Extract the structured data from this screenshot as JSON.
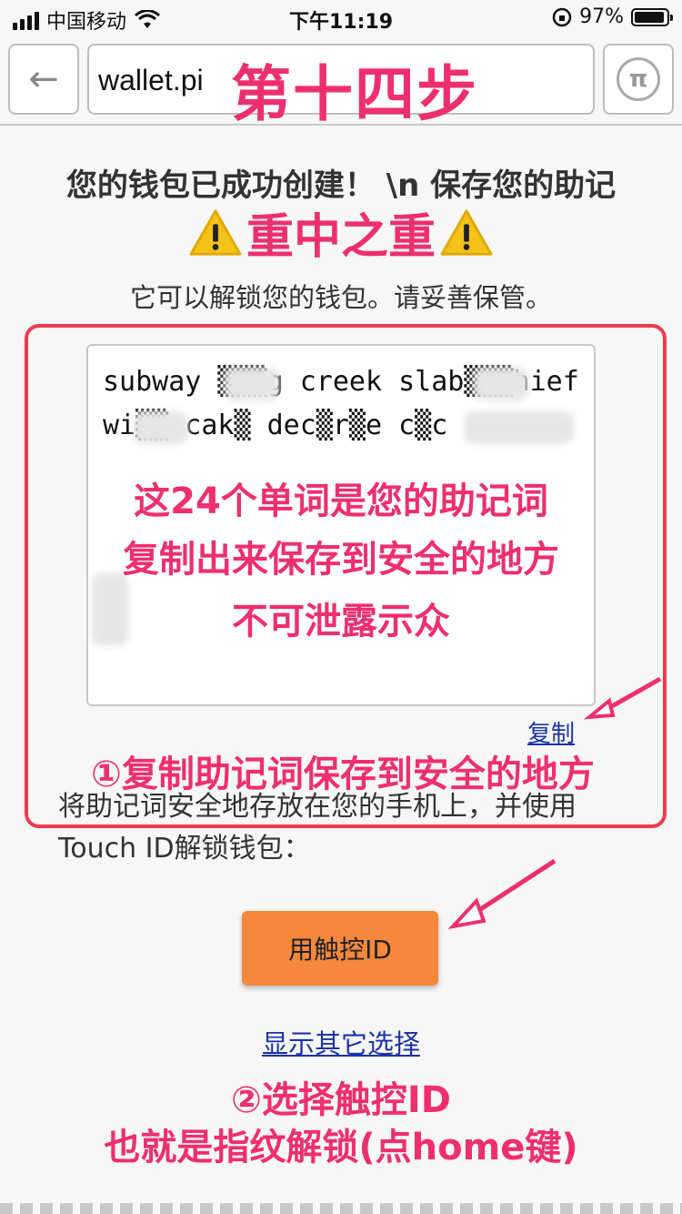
{
  "status_bar": {
    "carrier": "中国移动",
    "time": "下午11:19",
    "battery": "97%"
  },
  "nav": {
    "url": "wallet.pi",
    "overlay_step": "第十四步"
  },
  "content": {
    "title": "您的钱包已成功创建！ \\n 保存您的助记",
    "warning_label": "重中之重",
    "subtitle": "它可以解锁您的钱包。请妥善保管。",
    "mnemonic_line1": "subway ▒▒▒g creek slab▒▒▒hief",
    "mnemonic_line2": "wi▒▒ cak▒ dec▒r▒e c▒c",
    "notes": [
      "这24个单词是您的助记词",
      "复制出来保存到安全的地方",
      "不可泄露示众"
    ],
    "copy_link": "复制",
    "step1": "①复制助记词保存到安全的地方",
    "description": "将助记词安全地存放在您的手机上，并使用Touch ID解锁钱包：",
    "touch_button": "用触控ID",
    "other_options_link": "显示其它选择",
    "step2_line1": "②选择触控ID",
    "step2_line2": "也就是指纹解锁(点home键)"
  },
  "colors": {
    "annotation_red": "#ee2f6e",
    "box_red": "#ee3b4f",
    "button_orange": "#f5883a",
    "link_blue": "#1a33a8"
  },
  "icons": [
    "back-arrow-icon",
    "pi-logo-icon",
    "warning-icon",
    "wifi-icon",
    "battery-icon",
    "signal-icon",
    "rotation-lock-icon",
    "annotation-arrow-icon"
  ]
}
